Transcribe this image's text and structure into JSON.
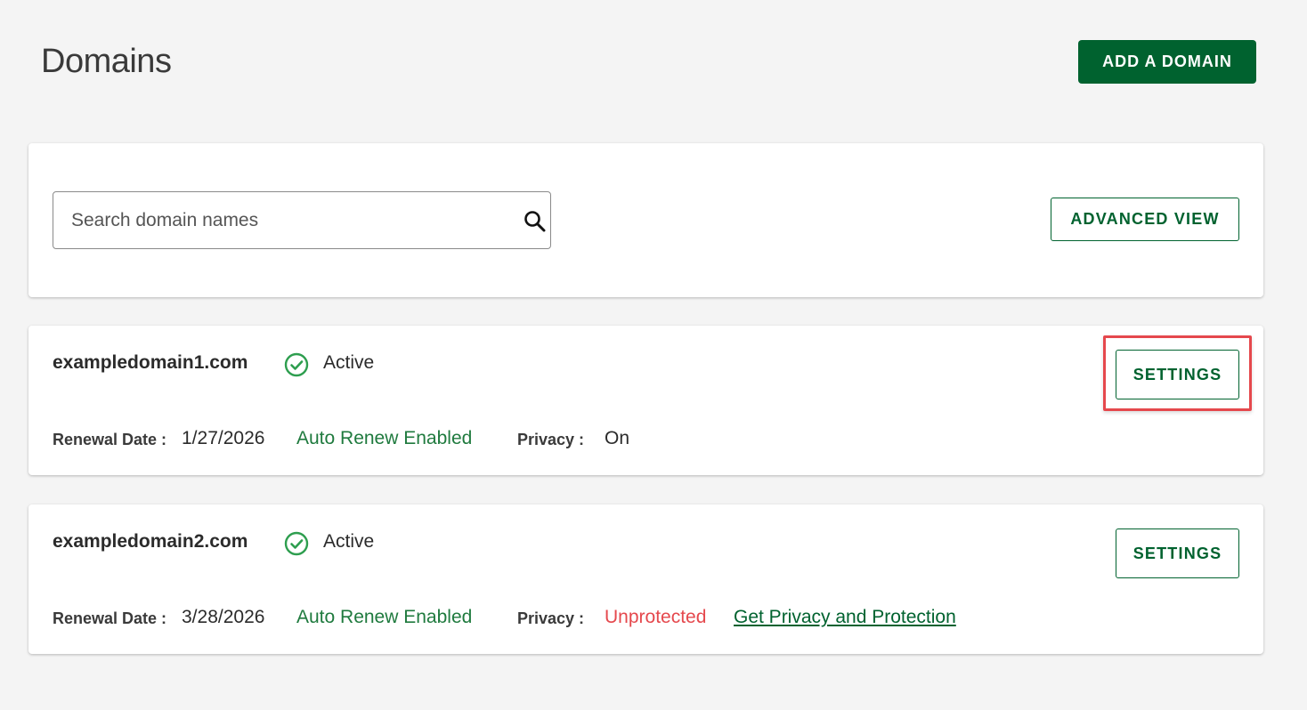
{
  "header": {
    "title": "Domains",
    "add_button": "ADD A DOMAIN"
  },
  "search": {
    "placeholder": "Search domain names",
    "value": "",
    "advanced_button": "ADVANCED VIEW"
  },
  "domains": [
    {
      "name": "exampledomain1.com",
      "status": "Active",
      "settings_label": "SETTINGS",
      "renewal_label": "Renewal Date :",
      "renewal_date": "1/27/2026",
      "auto_renew": "Auto Renew Enabled",
      "privacy_label": "Privacy :",
      "privacy_value": "On",
      "highlighted": true
    },
    {
      "name": "exampledomain2.com",
      "status": "Active",
      "settings_label": "SETTINGS",
      "renewal_label": "Renewal Date :",
      "renewal_date": "3/28/2026",
      "auto_renew": "Auto Renew Enabled",
      "privacy_label": "Privacy :",
      "privacy_value": "Unprotected",
      "privacy_link": "Get Privacy and Protection",
      "highlighted": false
    }
  ],
  "icons": {
    "status": "check-circle-icon",
    "search": "search-icon"
  },
  "colors": {
    "brand_green": "#00622f",
    "auto_renew_green": "#1f7a3e",
    "status_green": "#2e9e4f",
    "warning_red": "#e5484d",
    "highlight_red": "#e5484d"
  }
}
